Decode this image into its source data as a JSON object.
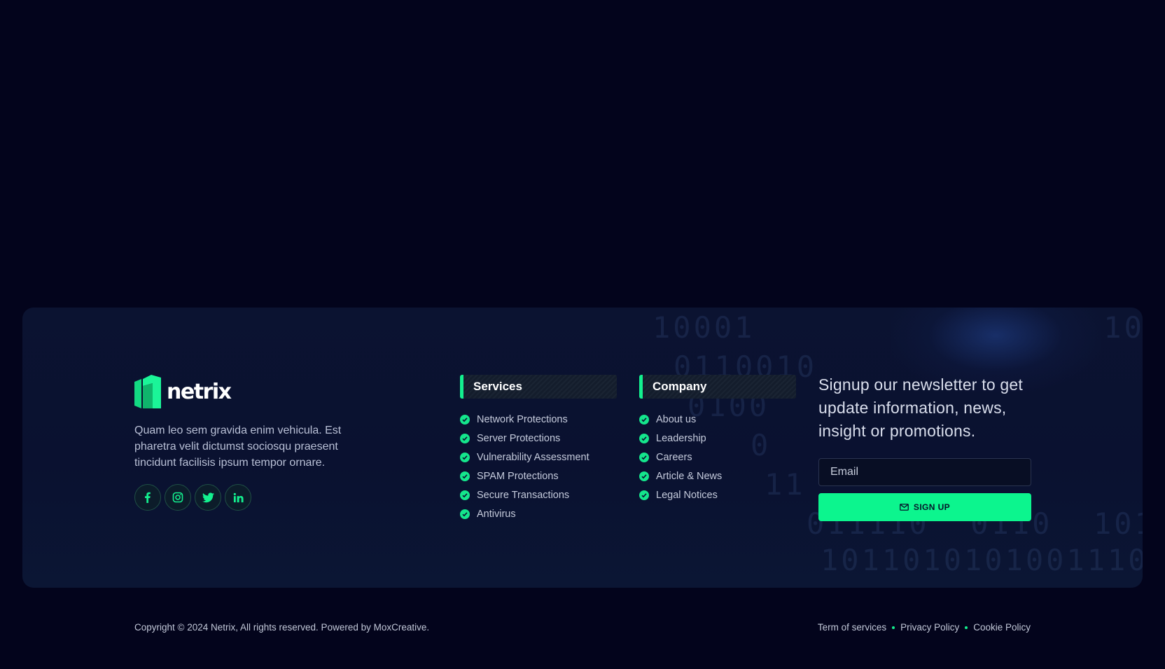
{
  "brand": {
    "name": "netrix",
    "description": "Quam leo sem gravida enim vehicula. Est pharetra velit dictumst sociosqu praesent tincidunt facilisis ipsum tempor ornare."
  },
  "socials": [
    {
      "icon": "facebook-icon"
    },
    {
      "icon": "instagram-icon"
    },
    {
      "icon": "twitter-icon"
    },
    {
      "icon": "linkedin-icon"
    }
  ],
  "services": {
    "heading": "Services",
    "items": [
      "Network Protections",
      "Server Protections",
      "Vulnerability Assessment",
      "SPAM Protections",
      "Secure Transactions",
      "Antivirus"
    ]
  },
  "company": {
    "heading": "Company",
    "items": [
      "About us",
      "Leadership",
      "Careers",
      "Article & News",
      "Legal Notices"
    ]
  },
  "newsletter": {
    "text": "Signup our newsletter to get update information, news, insight or promotions.",
    "email_placeholder": "Email",
    "button_label": "SIGN UP"
  },
  "footer": {
    "copyright": "Copyright © 2024 Netrix, All rights reserved. Powered by MoxCreative.",
    "links": [
      "Term of services",
      "Privacy Policy",
      "Cookie Policy"
    ]
  },
  "colors": {
    "background": "#03041c",
    "card": "#0b1331",
    "accent": "#0cf58e"
  }
}
